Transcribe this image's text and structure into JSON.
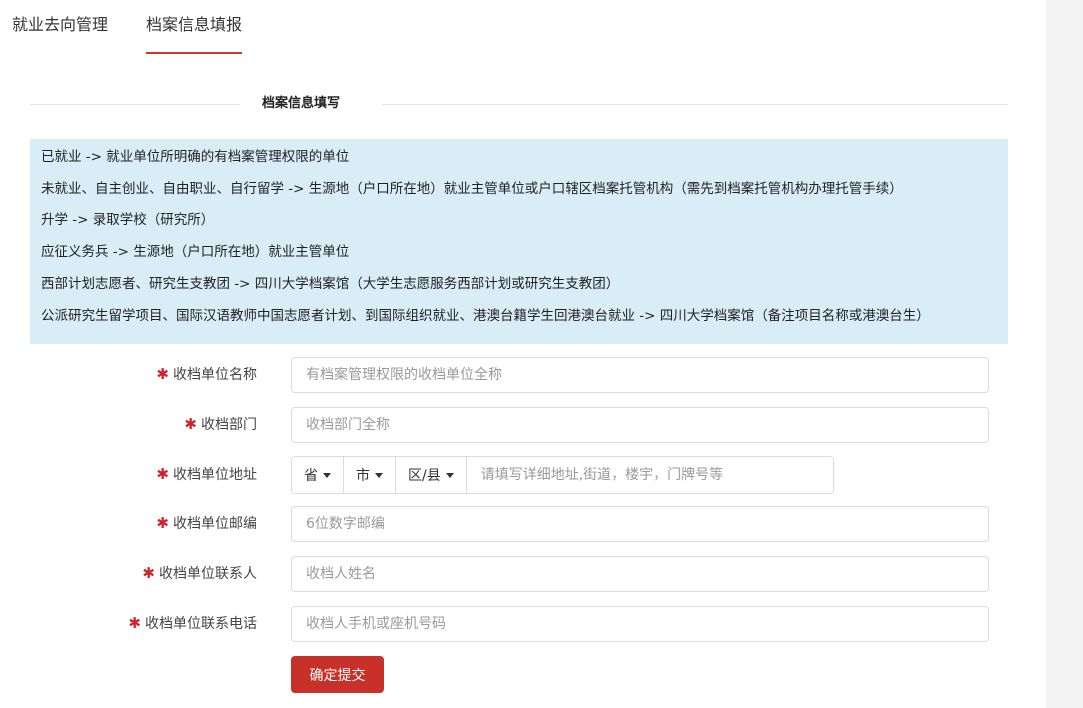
{
  "tabs": [
    {
      "label": "就业去向管理",
      "active": false
    },
    {
      "label": "档案信息填报",
      "active": true
    }
  ],
  "section_title": "档案信息填写",
  "info_lines": [
    "已就业 -> 就业单位所明确的有档案管理权限的单位",
    "未就业、自主创业、自由职业、自行留学 -> 生源地（户口所在地）就业主管单位或户口辖区档案托管机构（需先到档案托管机构办理托管手续）",
    "升学 -> 录取学校（研究所）",
    "应征义务兵 -> 生源地（户口所在地）就业主管单位",
    "西部计划志愿者、研究生支教团 -> 四川大学档案馆（大学生志愿服务西部计划或研究生支教团）",
    "公派研究生留学项目、国际汉语教师中国志愿者计划、到国际组织就业、港澳台籍学生回港澳台就业 -> 四川大学档案馆（备注项目名称或港澳台生）"
  ],
  "form": {
    "required_mark": "✱",
    "unit_name": {
      "label": "收档单位名称",
      "placeholder": "有档案管理权限的收档单位全称",
      "value": ""
    },
    "department": {
      "label": "收档部门",
      "placeholder": "收档部门全称",
      "value": ""
    },
    "address": {
      "label": "收档单位地址",
      "province": "省",
      "city": "市",
      "district": "区/县",
      "detail_placeholder": "请填写详细地址,街道，楼宇，门牌号等",
      "detail_value": ""
    },
    "postcode": {
      "label": "收档单位邮编",
      "placeholder": "6位数字邮编",
      "value": ""
    },
    "contact": {
      "label": "收档单位联系人",
      "placeholder": "收档人姓名",
      "value": ""
    },
    "phone": {
      "label": "收档单位联系电话",
      "placeholder": "收档人手机或座机号码",
      "value": ""
    },
    "submit_label": "确定提交"
  },
  "colors": {
    "accent": "#c8302a",
    "info_bg": "#d9edf7",
    "required": "#d0242b"
  }
}
